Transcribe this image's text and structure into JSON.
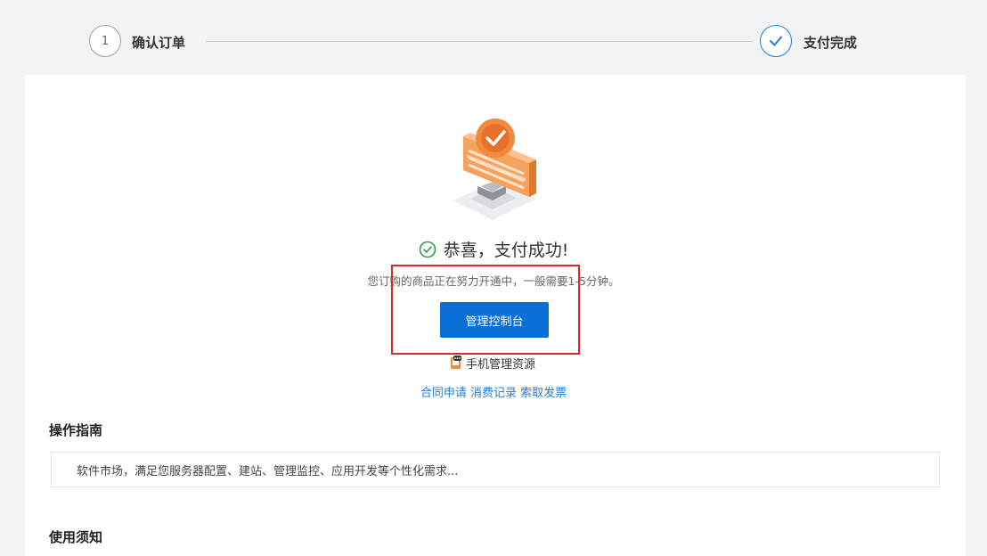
{
  "stepper": {
    "step1": {
      "number": "1",
      "label": "确认订单"
    },
    "step2": {
      "label": "支付完成",
      "icon": "check-icon"
    }
  },
  "result": {
    "title": "恭喜，支付成功!",
    "subtitle": "您订购的商品正在努力开通中，一般需要1-5分钟。",
    "console_button": "管理控制台",
    "mobile_manage": "手机管理资源",
    "links": [
      "合同申请",
      "消费记录",
      "索取发票"
    ]
  },
  "guide": {
    "title": "操作指南",
    "text": "软件市场，满足您服务器配置、建站、管理监控、应用开发等个性化需求..."
  },
  "notice": {
    "title": "使用须知"
  },
  "colors": {
    "primary": "#0a6fd6",
    "link": "#1f7ed6",
    "success": "#2e9d4f",
    "highlight": "#d72a2a",
    "illustration_orange": "#f08a3c"
  }
}
